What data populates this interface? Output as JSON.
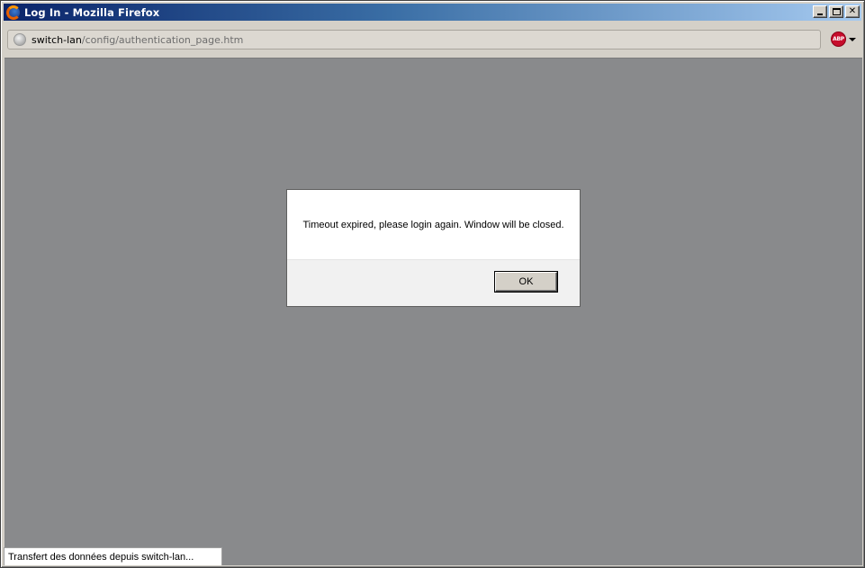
{
  "window": {
    "title": "Log In - Mozilla Firefox",
    "app_icon": "firefox-icon",
    "controls": {
      "minimize_icon": "minimize-icon",
      "maximize_icon": "maximize-icon",
      "close_label": "✕"
    }
  },
  "urlbar": {
    "host": "switch-lan",
    "path": "/config/authentication_page.htm",
    "site_icon": "globe-icon"
  },
  "addons": {
    "abp_label": "ABP",
    "abp_menu_icon": "dropdown-arrow-icon"
  },
  "dialog": {
    "message": "Timeout expired, please login again. Window will be closed.",
    "ok_label": "OK"
  },
  "statusbar": {
    "text": "Transfert des données depuis switch-lan..."
  },
  "colors": {
    "title_gradient_start": "#0a246a",
    "title_gradient_end": "#a6caf0",
    "overlay_gray": "#898a8c",
    "abp_red": "#c70d2c"
  }
}
